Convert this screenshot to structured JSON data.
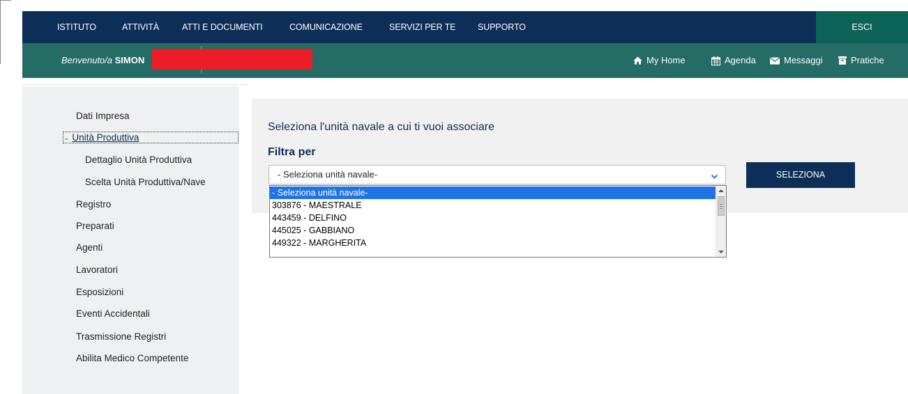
{
  "topnav": {
    "items": [
      "ISTITUTO",
      "ATTIVITÀ",
      "ATTI E DOCUMENTI",
      "COMUNICAZIONE",
      "SERVIZI PER TE",
      "SUPPORTO"
    ],
    "logout_label": "ESCI"
  },
  "userbar": {
    "welcome_prefix": "Benvenuto/a",
    "user_name": "SIMON",
    "quick_links": [
      {
        "label": "My Home",
        "icon": "home-icon"
      },
      {
        "label": "Agenda",
        "icon": "calendar-icon"
      },
      {
        "label": "Messaggi",
        "icon": "envelope-icon"
      },
      {
        "label": "Pratiche",
        "icon": "archive-icon"
      }
    ]
  },
  "sidebar": {
    "items": [
      {
        "label": "Dati Impresa"
      },
      {
        "label": "Unità Produttiva",
        "active": true
      },
      {
        "label": "Dettaglio Unità Produttiva"
      },
      {
        "label": "Scelta Unità Produttiva/Nave"
      },
      {
        "label": "Registro"
      },
      {
        "label": "Preparati"
      },
      {
        "label": "Agenti"
      },
      {
        "label": "Lavoratori"
      },
      {
        "label": "Esposizioni"
      },
      {
        "label": "Eventi Accidentali"
      },
      {
        "label": "Trasmissione Registri"
      },
      {
        "label": "Abilita Medico Competente"
      }
    ]
  },
  "main": {
    "title": "Seleziona l'unità navale a cui ti vuoi associare",
    "filter_label": "Filtra per",
    "select_value": "- Seleziona unità navale-",
    "options": [
      "- Seleziona unità navale-",
      "303876 - MAESTRALE",
      "443459 - DELFINO",
      "445025 - GABBIANO",
      "449322 - MARGHERITA"
    ],
    "button_label": "SELEZIONA"
  },
  "colors": {
    "nav_bg": "#0d2e57",
    "userbar_bg": "#256b66",
    "logout_bg": "#0b6358",
    "accent": "#1e73e8",
    "redaction": "#ee1c25"
  }
}
